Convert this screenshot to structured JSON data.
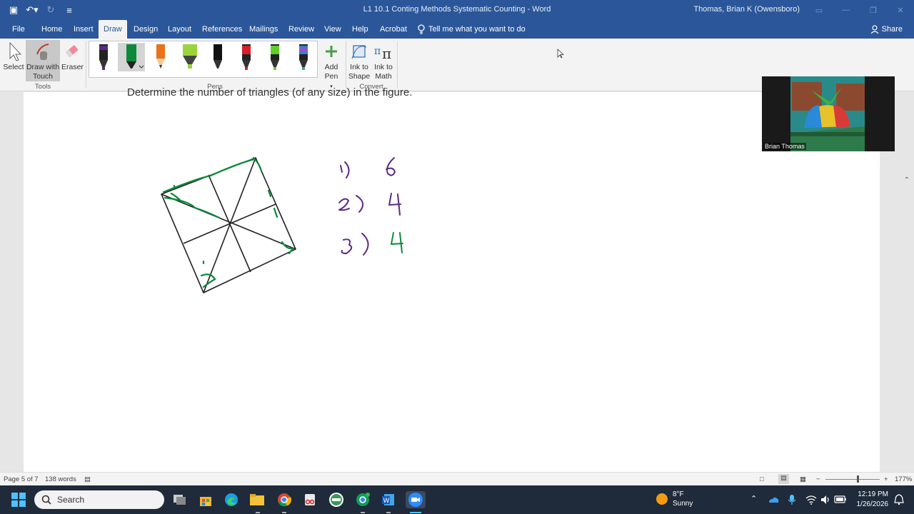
{
  "window": {
    "title": "L1 10.1 Conting Methods Systematic Counting  -  Word",
    "user": "Thomas, Brian K (Owensboro)"
  },
  "menu": {
    "tabs": [
      "File",
      "Home",
      "Insert",
      "Draw",
      "Design",
      "Layout",
      "References",
      "Mailings",
      "Review",
      "View",
      "Help",
      "Acrobat"
    ],
    "active_tab": "Draw",
    "tell_me": "Tell me what you want to do",
    "share": "Share"
  },
  "ribbon": {
    "select": "Select",
    "draw_with_touch": "Draw with Touch",
    "eraser": "Eraser",
    "tools_label": "Tools",
    "pens_label": "Pens",
    "add_pen": "Add Pen",
    "ink_to_shape": "Ink to Shape",
    "ink_to_math": "Ink to Math",
    "convert_label": "Convert",
    "pen_colors": [
      "#5b2a86",
      "#0b8a3a",
      "#e8731a",
      "#9bd43a",
      "#111111",
      "#d81e2a",
      "#5fd02a",
      "#3a7bd5"
    ]
  },
  "document": {
    "prompt": "Determine the number of triangles (of any size) in the figure.",
    "handwriting": [
      {
        "label": "1)",
        "value": "6"
      },
      {
        "label": "2)",
        "value": "4"
      },
      {
        "label": "3)",
        "value": "4"
      }
    ]
  },
  "video": {
    "participant": "Brian Thomas"
  },
  "status": {
    "page": "Page 5 of 7",
    "words": "138 words",
    "zoom": "177%"
  },
  "taskbar": {
    "search": "Search",
    "temperature": "8°F",
    "condition": "Sunny",
    "time": "12:19 PM",
    "date": "1/26/2026"
  }
}
